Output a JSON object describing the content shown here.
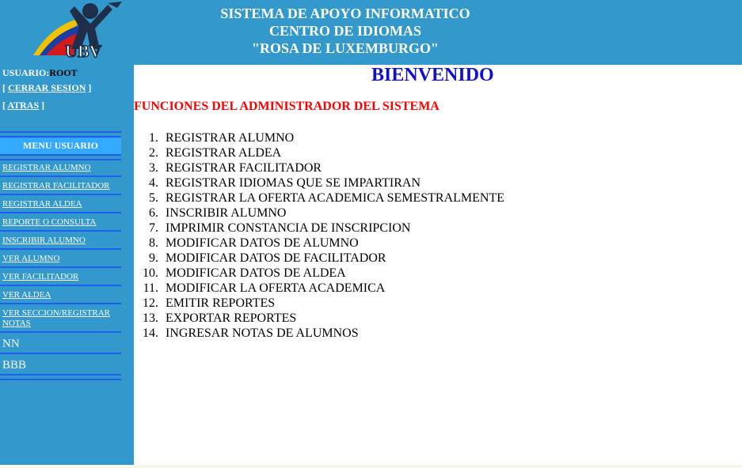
{
  "header": {
    "logo_text": "UBV",
    "title_lines": [
      "SISTEMA DE APOYO INFORMATICO",
      "CENTRO DE IDIOMAS",
      "\"ROSA DE LUXEMBURGO\""
    ]
  },
  "sidebar": {
    "user_label": "USUARIO:",
    "user_name": "ROOT",
    "logout_label": "CERRAR SESION",
    "back_label": "ATRAS",
    "menu_title": "MENU USUARIO",
    "menu_items": [
      "REGISTRAR ALUMNO",
      "REGISTRAR FACILITADOR",
      "REGISTRAR ALDEA",
      "REPORTE O CONSULTA",
      "INSCRIBIR ALUMNO",
      "VER ALUMNO",
      "VER FACILITADOR",
      "VER ALDEA",
      "VER SECCION/REGISTRAR NOTAS"
    ],
    "extra_items": [
      "NN",
      "BBB"
    ]
  },
  "main": {
    "welcome": "BIENVENIDO",
    "admin_title": "FUNCIONES DEL ADMINISTRADOR DEL SISTEMA",
    "functions": [
      "REGISTRAR ALUMNO",
      "REGISTRAR ALDEA",
      "REGISTRAR FACILITADOR",
      "REGISTRAR IDIOMAS QUE SE IMPARTIRAN",
      "REGISTRAR LA OFERTA ACADEMICA SEMESTRALMENTE",
      "INSCRIBIR ALUMNO",
      "IMPRIMIR CONSTANCIA DE INSCRIPCION",
      "MODIFICAR DATOS DE ALUMNO",
      "MODIFICAR DATOS DE FACILITADOR",
      "MODIFICAR DATOS DE ALDEA",
      "MODIFICAR LA OFERTA ACADEMICA",
      "EMITIR REPORTES",
      "EXPORTAR REPORTES",
      "INGRESAR NOTAS DE ALUMNOS"
    ]
  },
  "colors": {
    "header_bg": "#3399cc",
    "menu_title_bg": "#33aaff",
    "menu_line": "#1e5ef0",
    "welcome": "#1111cc",
    "admin_title": "#ff0000"
  }
}
